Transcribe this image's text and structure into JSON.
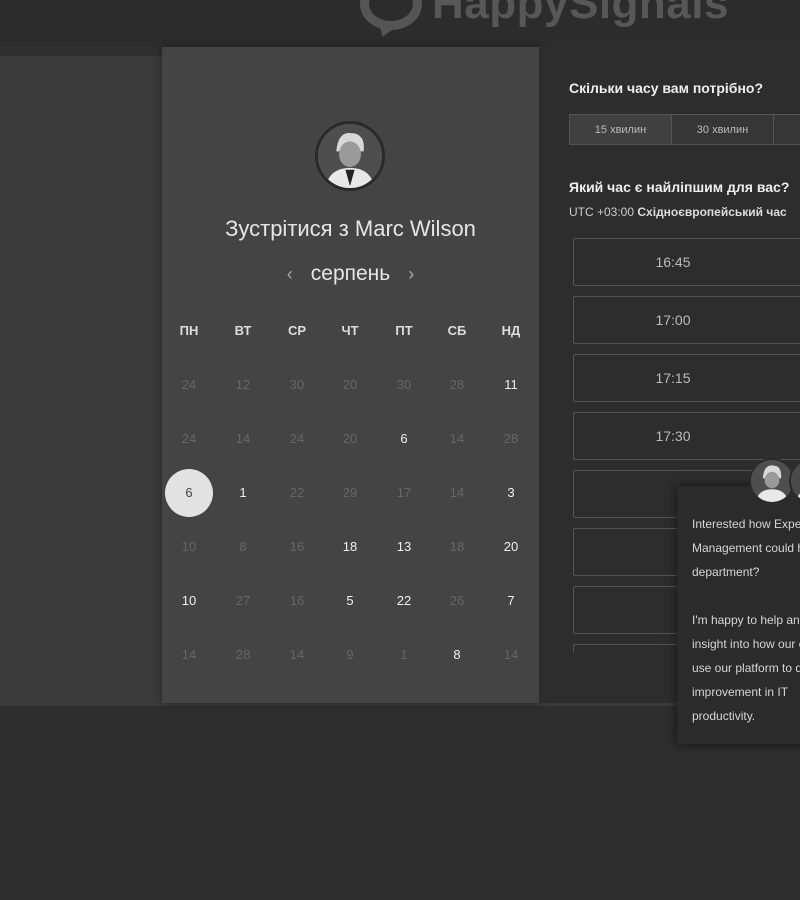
{
  "brand": {
    "name": "HappySignals"
  },
  "booking": {
    "title": "Зустрітися з Marc Wilson",
    "month": "серпень",
    "prev_arrow": "‹",
    "next_arrow": "›",
    "weekdays": [
      "ПН",
      "ВТ",
      "СР",
      "ЧТ",
      "ПТ",
      "СБ",
      "НД"
    ],
    "weeks": [
      [
        {
          "d": "24",
          "s": "dim"
        },
        {
          "d": "12",
          "s": "dim"
        },
        {
          "d": "30",
          "s": "dim"
        },
        {
          "d": "20",
          "s": "dim"
        },
        {
          "d": "30",
          "s": "dim"
        },
        {
          "d": "28",
          "s": "dim"
        },
        {
          "d": "11",
          "s": "active"
        }
      ],
      [
        {
          "d": "24",
          "s": "dim"
        },
        {
          "d": "14",
          "s": "dim"
        },
        {
          "d": "24",
          "s": "dim"
        },
        {
          "d": "20",
          "s": "dim"
        },
        {
          "d": "6",
          "s": "active"
        },
        {
          "d": "14",
          "s": "dim"
        },
        {
          "d": "28",
          "s": "dim"
        }
      ],
      [
        {
          "d": "6",
          "s": "selected"
        },
        {
          "d": "1",
          "s": "active"
        },
        {
          "d": "22",
          "s": "dim"
        },
        {
          "d": "29",
          "s": "dim"
        },
        {
          "d": "17",
          "s": "dim"
        },
        {
          "d": "14",
          "s": "dim"
        },
        {
          "d": "3",
          "s": "active"
        }
      ],
      [
        {
          "d": "10",
          "s": "dim"
        },
        {
          "d": "8",
          "s": "dim"
        },
        {
          "d": "16",
          "s": "dim"
        },
        {
          "d": "18",
          "s": "active"
        },
        {
          "d": "13",
          "s": "active"
        },
        {
          "d": "18",
          "s": "dim"
        },
        {
          "d": "20",
          "s": "active"
        }
      ],
      [
        {
          "d": "10",
          "s": "active"
        },
        {
          "d": "27",
          "s": "dim"
        },
        {
          "d": "16",
          "s": "dim"
        },
        {
          "d": "5",
          "s": "active"
        },
        {
          "d": "22",
          "s": "active"
        },
        {
          "d": "26",
          "s": "dim"
        },
        {
          "d": "7",
          "s": "active"
        }
      ],
      [
        {
          "d": "14",
          "s": "dim"
        },
        {
          "d": "28",
          "s": "dim"
        },
        {
          "d": "14",
          "s": "dim"
        },
        {
          "d": "9",
          "s": "dim"
        },
        {
          "d": "1",
          "s": "dim"
        },
        {
          "d": "8",
          "s": "active"
        },
        {
          "d": "14",
          "s": "dim"
        }
      ]
    ]
  },
  "scheduler": {
    "duration_question": "Скільки часу вам потрібно?",
    "durations": [
      "15 хвилин",
      "30 хвилин",
      ""
    ],
    "time_question": "Який час є найліпшим для вас?",
    "timezone_offset": "UTC +03:00",
    "timezone_name": "Східноєвропейський час",
    "slots": [
      "16:45",
      "17:00",
      "17:15",
      "17:30",
      "",
      "",
      "",
      ""
    ]
  },
  "chat": {
    "message": "Interested how Experience\nManagement could help your\ndepartment?\n\nI'm happy to help and give\ninsight into how our customers\nuse our platform to drive\nimprovement in IT\nproductivity."
  }
}
